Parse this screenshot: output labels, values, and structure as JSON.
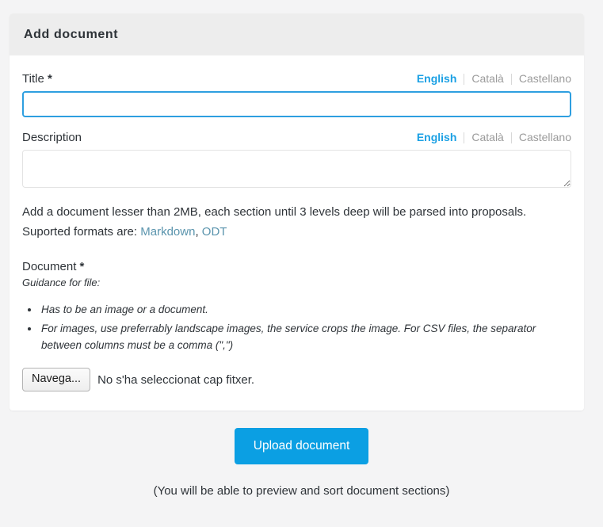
{
  "card": {
    "header_title": "Add document"
  },
  "title_field": {
    "label": "Title",
    "required_marker": "*",
    "value": "",
    "placeholder": "",
    "locales": [
      {
        "label": "English",
        "active": true
      },
      {
        "label": "Català",
        "active": false
      },
      {
        "label": "Castellano",
        "active": false
      }
    ]
  },
  "description_field": {
    "label": "Description",
    "value": "",
    "placeholder": "",
    "locales": [
      {
        "label": "English",
        "active": true
      },
      {
        "label": "Català",
        "active": false
      },
      {
        "label": "Castellano",
        "active": false
      }
    ]
  },
  "help": {
    "line1": "Add a document lesser than 2MB, each section until 3 levels deep will be parsed into proposals.",
    "line2_prefix": "Suported formats are: ",
    "link_markdown": "Markdown",
    "separator": ", ",
    "link_odt": "ODT"
  },
  "document_field": {
    "label": "Document",
    "required_marker": "*",
    "guidance_title": "Guidance for file:",
    "guidance_items": [
      "Has to be an image or a document.",
      "For images, use preferrably landscape images, the service crops the image. For CSV files, the separator between columns must be a comma (\",\")"
    ],
    "browse_button_label": "Navega...",
    "file_status": "No s'ha seleccionat cap fitxer."
  },
  "footer": {
    "submit_label": "Upload document",
    "note": "(You will be able to preview and sort document sections)"
  },
  "colors": {
    "accent": "#0b9fe3",
    "active_tab": "#1aa0e4",
    "link": "#5a94ad",
    "page_background": "#f4f4f5",
    "card_header": "#ededed"
  }
}
